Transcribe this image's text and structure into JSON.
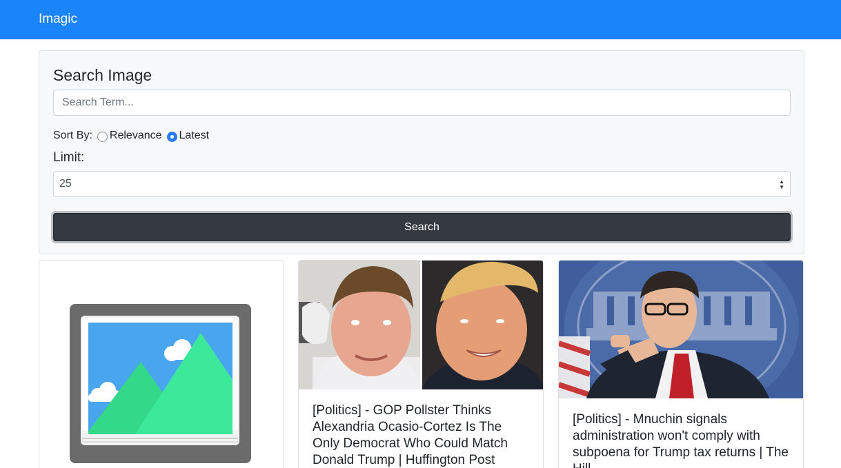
{
  "navbar": {
    "brand": "Imagic"
  },
  "search_panel": {
    "title": "Search Image",
    "search_input": {
      "placeholder": "Search Term...",
      "value": ""
    },
    "sort_label": "Sort By:",
    "sort_options": [
      {
        "label": "Relevance",
        "selected": false
      },
      {
        "label": "Latest",
        "selected": true
      }
    ],
    "limit_label": "Limit:",
    "limit_value": "25",
    "search_button": "Search"
  },
  "results": [
    {
      "title": "",
      "image": "placeholder-image-icon"
    },
    {
      "title": "[Politics] - GOP Pollster Thinks Alexandria Ocasio-Cortez Is The Only Democrat Who Could Match Donald Trump | Huffington Post",
      "image": "two-men-photo"
    },
    {
      "title": "[Politics] - Mnuchin signals administration won't comply with subpoena for Trump tax returns | The Hill",
      "image": "white-house-briefing-photo"
    }
  ],
  "colors": {
    "navbar": "#1a85fb",
    "button": "#343a40",
    "accent": "#2b7cf7"
  }
}
